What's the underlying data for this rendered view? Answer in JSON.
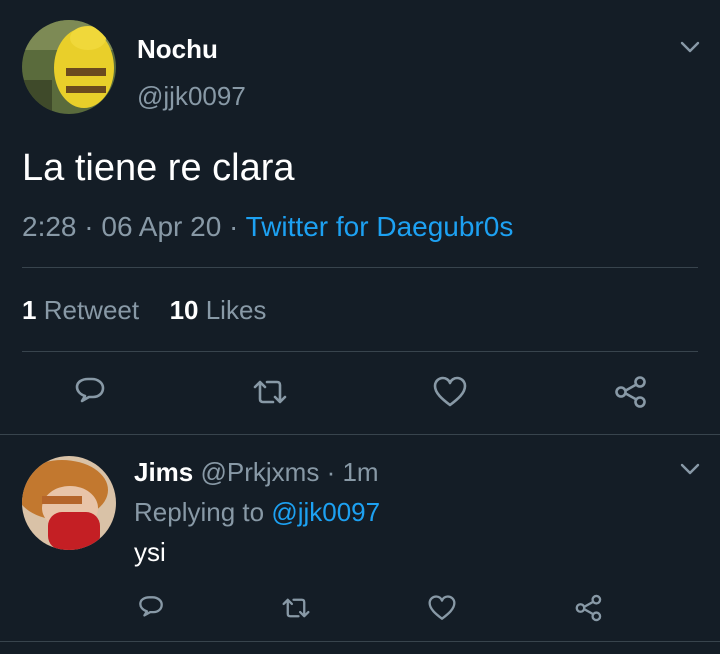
{
  "main_tweet": {
    "display_name": "Nochu",
    "handle": "@jjk0097",
    "text": "La tiene re clara",
    "time": "2:28",
    "date": "06 Apr 20",
    "separator": "·",
    "source": "Twitter for Daegubr0s",
    "retweet_count": "1",
    "retweet_label": "Retweet",
    "like_count": "10",
    "like_label": "Likes"
  },
  "reply": {
    "display_name": "Jims",
    "handle": "@Prkjxms",
    "separator": "·",
    "age": "1m",
    "replying_to_label": "Replying to",
    "replying_to_handle": "@jjk0097",
    "text": "ysi"
  },
  "icons": {
    "menu": "chevron-down-icon",
    "reply": "reply-icon",
    "retweet": "retweet-icon",
    "like": "heart-icon",
    "share": "share-icon"
  },
  "colors": {
    "background": "#141d26",
    "text": "#ffffff",
    "muted": "#8899a6",
    "accent": "#1da1f2",
    "divider": "#38444d"
  }
}
